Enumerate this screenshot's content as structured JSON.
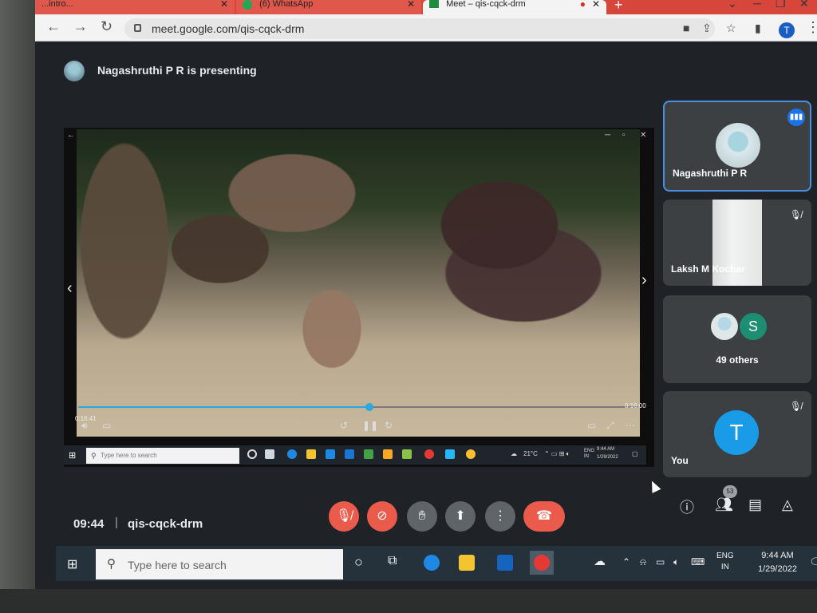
{
  "browser": {
    "tabs": [
      {
        "label": "...intro..."
      },
      {
        "label": "(6) WhatsApp"
      },
      {
        "label": "Meet – qis-cqck-drm"
      }
    ],
    "url": "meet.google.com/qis-cqck-drm",
    "profile_initial": "T"
  },
  "meet": {
    "presenting_text": "Nagashruthi P R is presenting",
    "time": "09:44",
    "separator": "|",
    "meeting_code": "qis-cqck-drm",
    "participant_count_badge": "53",
    "tiles": [
      {
        "name": "Nagashruthi P R",
        "speaking": true
      },
      {
        "name": "Laksh M Kochar",
        "muted": true
      },
      {
        "others_label": "49 others",
        "avatar_letter": "S"
      },
      {
        "name": "You",
        "avatar_letter": "T",
        "muted": true
      }
    ],
    "controls": [
      "mic-off",
      "camera-off",
      "raise-hand",
      "present",
      "more-options",
      "leave-call"
    ],
    "right_controls": [
      "info",
      "people",
      "chat",
      "activities"
    ]
  },
  "shared_screen": {
    "time_elapsed": "0:16:41",
    "time_total": "0:16:00",
    "progress_fraction": 0.52,
    "taskbar": {
      "search_placeholder": "Type here to search",
      "weather": "21°C",
      "lang": "ENG\nIN",
      "time": "9:44 AM",
      "date": "1/29/2022"
    }
  },
  "taskbar": {
    "search_placeholder": "Type here to search",
    "lang_line1": "ENG",
    "lang_line2": "IN",
    "time": "9:44 AM",
    "date": "1/29/2022"
  },
  "colors": {
    "meet_bg": "#1f2328",
    "tile_bg": "#3c4043",
    "active_border": "#4a90e2",
    "danger": "#ea5b4c",
    "accent": "#1a73e8"
  }
}
